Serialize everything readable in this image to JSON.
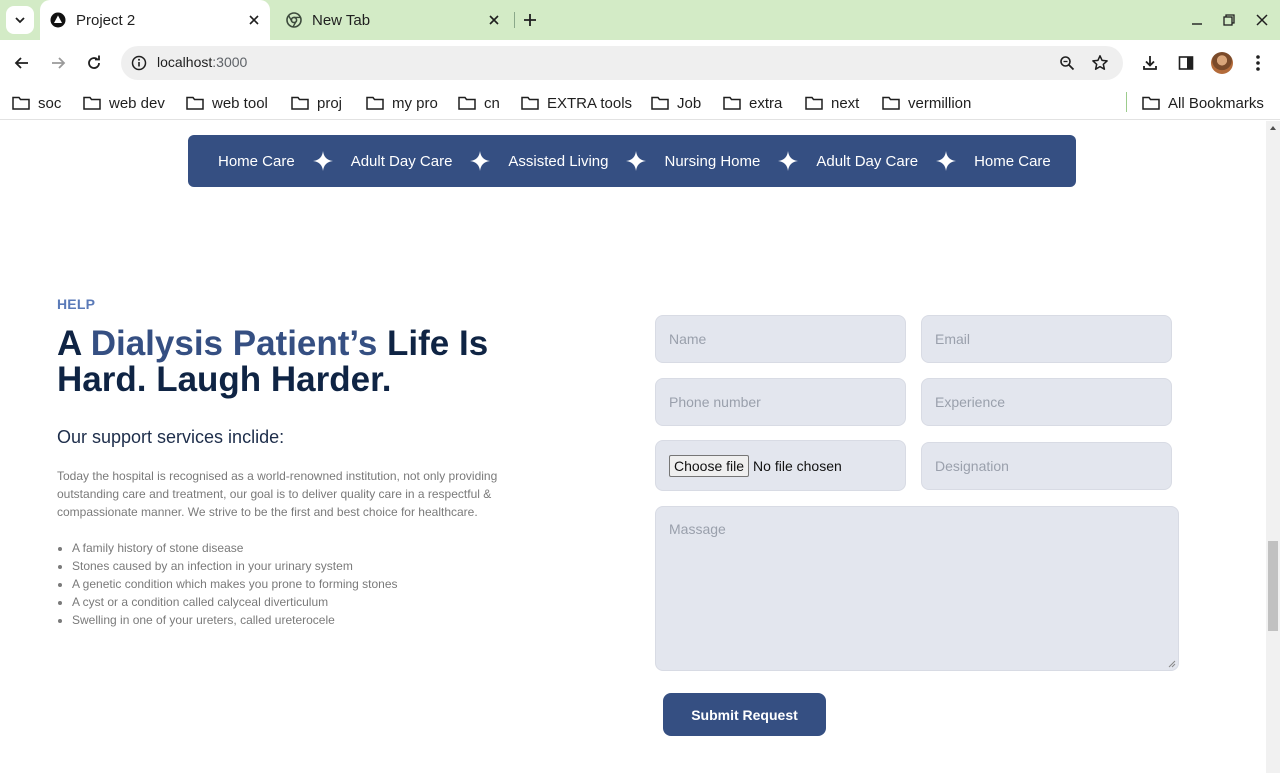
{
  "browser": {
    "tabs": [
      {
        "title": "Project 2",
        "active": true,
        "icon": "app-favicon"
      },
      {
        "title": "New Tab",
        "active": false,
        "icon": "chrome-icon"
      }
    ],
    "url_host": "localhost",
    "url_port": ":3000",
    "bookmarks": [
      "soc",
      "web dev",
      "web tool",
      "proj",
      "my pro",
      "cn",
      "EXTRA tools",
      "Job",
      "extra",
      "next",
      "vermillion"
    ],
    "all_bookmarks": "All Bookmarks"
  },
  "marquee": {
    "items": [
      "Home Care",
      "Adult Day Care",
      "Assisted Living",
      "Nursing Home",
      "Adult Day Care",
      "Home Care"
    ],
    "background": "#354f82"
  },
  "help": {
    "label": "HELP",
    "headline_a": "A ",
    "headline_accent": "Dialysis Patient’s",
    "headline_b": " Life Is Hard. Laugh Harder.",
    "subhead": "Our support services inclide:",
    "paragraph": "Today the hospital is recognised as a world-renowned institution, not only providing outstanding care and treatment, our goal is to deliver quality care in a respectful & compassionate manner. We strive to be the first and best choice for healthcare.",
    "bullets": [
      "A family history of stone disease",
      "Stones caused by an infection in your urinary system",
      "A genetic condition which makes you prone to forming stones",
      "A cyst or a condition called calyceal diverticulum",
      "Swelling in one of your ureters, called ureterocele"
    ]
  },
  "form": {
    "name_placeholder": "Name",
    "email_placeholder": "Email",
    "phone_placeholder": "Phone number",
    "experience_placeholder": "Experience",
    "choose_file": "Choose file",
    "no_file": "No file chosen",
    "designation_placeholder": "Designation",
    "message_placeholder": "Massage",
    "submit": "Submit Request"
  },
  "colors": {
    "accent": "#354f82",
    "heading": "#0f2444",
    "field_bg": "#e3e6ee",
    "tabbar": "#d3ebc6"
  }
}
